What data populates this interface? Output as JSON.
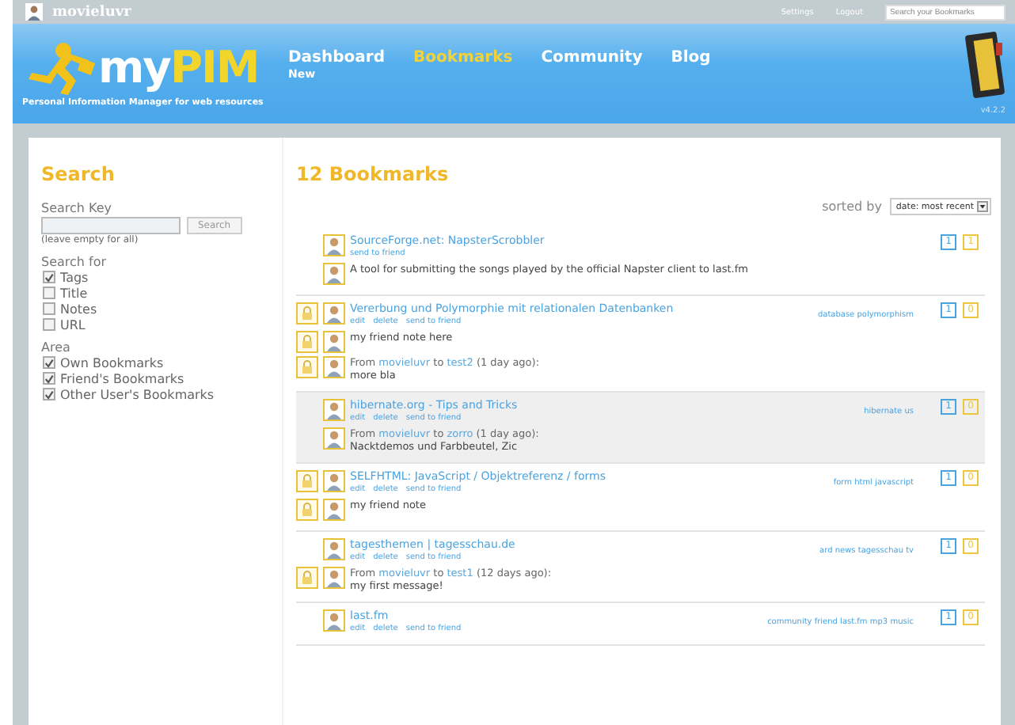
{
  "top_bar": {
    "user": "movieluvr",
    "links": [
      "Settings",
      "Logout"
    ],
    "search": {
      "placeholder": "Search your Bookmarks"
    }
  },
  "header": {
    "logo": {
      "first": "my",
      "second": "PIM"
    },
    "tagline": "Personal Information Manager for web resources",
    "version": "v4.2.2",
    "nav": [
      {
        "label": "Dashboard",
        "sub": "New",
        "selected": false
      },
      {
        "label": "Bookmarks",
        "selected": true
      },
      {
        "label": "Community",
        "selected": false
      },
      {
        "label": "Blog",
        "selected": false
      }
    ]
  },
  "sidebar": {
    "title": "Search",
    "search_key_label": "Search Key",
    "search_button": "Search",
    "hint": "(leave empty for all)",
    "groups": [
      {
        "label": "Search for",
        "options": [
          {
            "label": "Tags",
            "checked": true
          },
          {
            "label": "Title",
            "checked": false
          },
          {
            "label": "Notes",
            "checked": false
          },
          {
            "label": "URL",
            "checked": false
          }
        ]
      },
      {
        "label": "Area",
        "options": [
          {
            "label": "Own Bookmarks",
            "checked": true
          },
          {
            "label": "Friend's Bookmarks",
            "checked": true
          },
          {
            "label": "Other User's Bookmarks",
            "checked": true
          }
        ]
      }
    ]
  },
  "main": {
    "title": "12 Bookmarks",
    "sort_label": "sorted by",
    "sort_value": "date: most recent",
    "bookmarks": [
      {
        "title": "SourceForge.net: NapsterScrobbler",
        "locked": false,
        "highlighted": false,
        "actions": [
          "send to friend"
        ],
        "counters": [
          "1",
          "1"
        ],
        "notes": [
          {
            "locked": false,
            "text": "A tool for submitting the songs played by the official Napster client to last.fm"
          }
        ]
      },
      {
        "title": "Vererbung und Polymorphie mit relationalen Datenbanken",
        "locked": true,
        "highlighted": false,
        "actions": [
          "edit",
          "delete",
          "send to friend"
        ],
        "tags": "database polymorphism",
        "counters": [
          "1",
          "0"
        ],
        "notes": [
          {
            "locked": true,
            "text": "my friend note here"
          },
          {
            "locked": true,
            "from": {
              "prefix": "From",
              "sender": "movieluvr",
              "joiner": "to",
              "recipient": "test2",
              "age": "(1 day ago):"
            },
            "text": "more bla"
          }
        ]
      },
      {
        "title": "hibernate.org - Tips and Tricks",
        "locked": false,
        "highlighted": true,
        "actions": [
          "edit",
          "delete",
          "send to friend"
        ],
        "tags": "hibernate us",
        "counters": [
          "1",
          "0"
        ],
        "notes": [
          {
            "locked": false,
            "from": {
              "prefix": "From",
              "sender": "movieluvr",
              "joiner": "to",
              "recipient": "zorro",
              "age": "(1 day ago):"
            },
            "text": "Nacktdemos und Farbbeutel, Zic"
          }
        ]
      },
      {
        "title": "SELFHTML: JavaScript / Objektreferenz / forms",
        "locked": true,
        "highlighted": false,
        "actions": [
          "edit",
          "delete",
          "send to friend"
        ],
        "tags": "form html javascript",
        "counters": [
          "1",
          "0"
        ],
        "notes": [
          {
            "locked": true,
            "text": "my friend note"
          }
        ]
      },
      {
        "title": "tagesthemen | tagesschau.de",
        "locked": false,
        "highlighted": false,
        "actions": [
          "edit",
          "delete",
          "send to friend"
        ],
        "tags": "ard news tagesschau tv",
        "counters": [
          "1",
          "0"
        ],
        "notes": [
          {
            "locked": true,
            "from": {
              "prefix": "From",
              "sender": "movieluvr",
              "joiner": "to",
              "recipient": "test1",
              "age": "(12 days ago):"
            },
            "text": "my first message!"
          }
        ]
      },
      {
        "title": "last.fm",
        "locked": false,
        "highlighted": false,
        "actions": [
          "edit",
          "delete",
          "send to friend"
        ],
        "tags": "community friend last.fm mp3 music",
        "counters": [
          "1",
          "0"
        ]
      }
    ]
  }
}
